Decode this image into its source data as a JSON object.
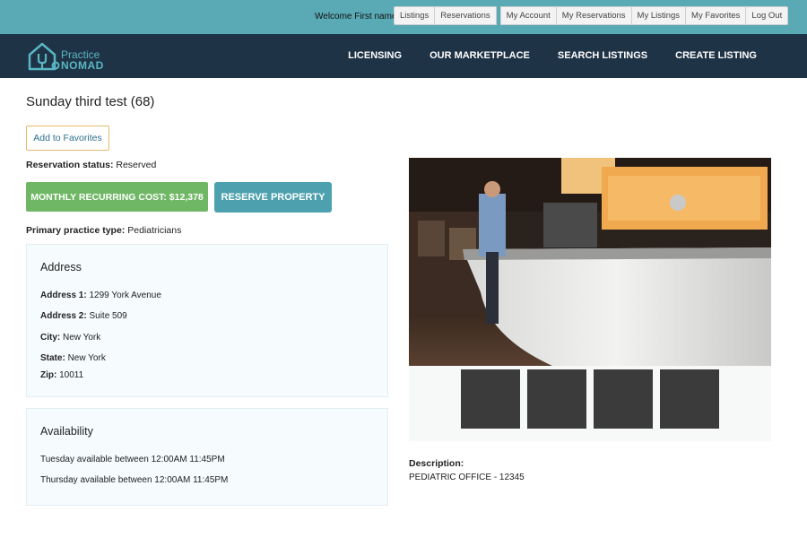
{
  "topbar": {
    "welcome": "Welcome First name",
    "links": [
      "Listings",
      "Reservations",
      "My Account",
      "My Reservations",
      "My Listings",
      "My Favorites",
      "Log Out"
    ]
  },
  "brand": {
    "line1": "Practice",
    "line2": "NOMAD"
  },
  "nav": [
    "LICENSING",
    "OUR MARKETPLACE",
    "SEARCH LISTINGS",
    "CREATE LISTING"
  ],
  "listing": {
    "title": "Sunday third test (68)",
    "favorites_label": "Add to Favorites",
    "status_label": "Reservation status:",
    "status_value": "Reserved",
    "cost_label": "MONTHLY RECURRING COST: $12,378",
    "reserve_label": "RESERVE PROPERTY",
    "ptype_label": "Primary practice type:",
    "ptype_value": "Pediatricians"
  },
  "address": {
    "heading": "Address",
    "fields": [
      {
        "label": "Address 1:",
        "value": "1299 York Avenue"
      },
      {
        "label": "Address 2:",
        "value": "Suite 509"
      },
      {
        "label": "City:",
        "value": "New York"
      },
      {
        "label": "State:",
        "value": "New York"
      },
      {
        "label": "Zip:",
        "value": "10011"
      }
    ]
  },
  "availability": {
    "heading": "Availability",
    "rows": [
      "Tuesday available between 12:00AM 11:45PM",
      "Thursday available between 12:00AM 11:45PM"
    ]
  },
  "description": {
    "label": "Description:",
    "text": "PEDIATRIC OFFICE - 12345"
  },
  "colors": {
    "topbar": "#5aaab6",
    "navbar": "#1f3346",
    "cost": "#6fb765",
    "reserve": "#4da1ae"
  }
}
